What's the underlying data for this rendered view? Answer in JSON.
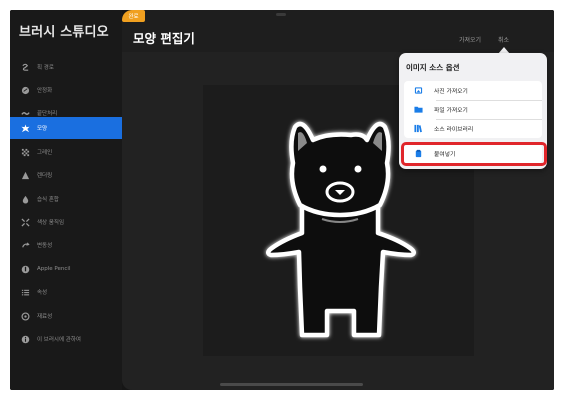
{
  "sidebar": {
    "title": "브러시 스튜디오",
    "items": [
      {
        "label": "획 경로",
        "icon": "stroke-path-icon",
        "active": false
      },
      {
        "label": "안정화",
        "icon": "stabilization-icon",
        "active": false
      },
      {
        "label": "끝단처리",
        "icon": "taper-icon",
        "active": false
      },
      {
        "label": "모양",
        "icon": "shape-icon",
        "active": true
      },
      {
        "label": "그레인",
        "icon": "grain-icon",
        "active": false
      },
      {
        "label": "렌더링",
        "icon": "rendering-icon",
        "active": false
      },
      {
        "label": "습식 혼합",
        "icon": "wet-mix-icon",
        "active": false
      },
      {
        "label": "색상 움직임",
        "icon": "color-dynamics-icon",
        "active": false
      },
      {
        "label": "변동성",
        "icon": "dynamics-icon",
        "active": false
      },
      {
        "label": "Apple Pencil",
        "icon": "apple-pencil-icon",
        "active": false
      },
      {
        "label": "속성",
        "icon": "properties-icon",
        "active": false
      },
      {
        "label": "재료성",
        "icon": "materials-icon",
        "active": false
      },
      {
        "label": "이 브러시에 관하여",
        "icon": "info-icon",
        "active": false
      }
    ]
  },
  "header": {
    "title": "모양 편집기",
    "import_label": "가져오기",
    "cancel_label": "취소",
    "done_label": "완료"
  },
  "popover": {
    "title": "이미지 소스 옵션",
    "items": [
      {
        "label": "사진 가져오기",
        "icon": "photo-import-icon"
      },
      {
        "label": "파일 가져오기",
        "icon": "folder-icon"
      },
      {
        "label": "소스 라이브러리",
        "icon": "library-icon"
      }
    ],
    "paste_label": "붙여넣기",
    "paste_icon": "paste-icon"
  },
  "colors": {
    "accent": "#1a6fe0",
    "done_button": "#f0a020",
    "highlight": "#e0262b"
  }
}
